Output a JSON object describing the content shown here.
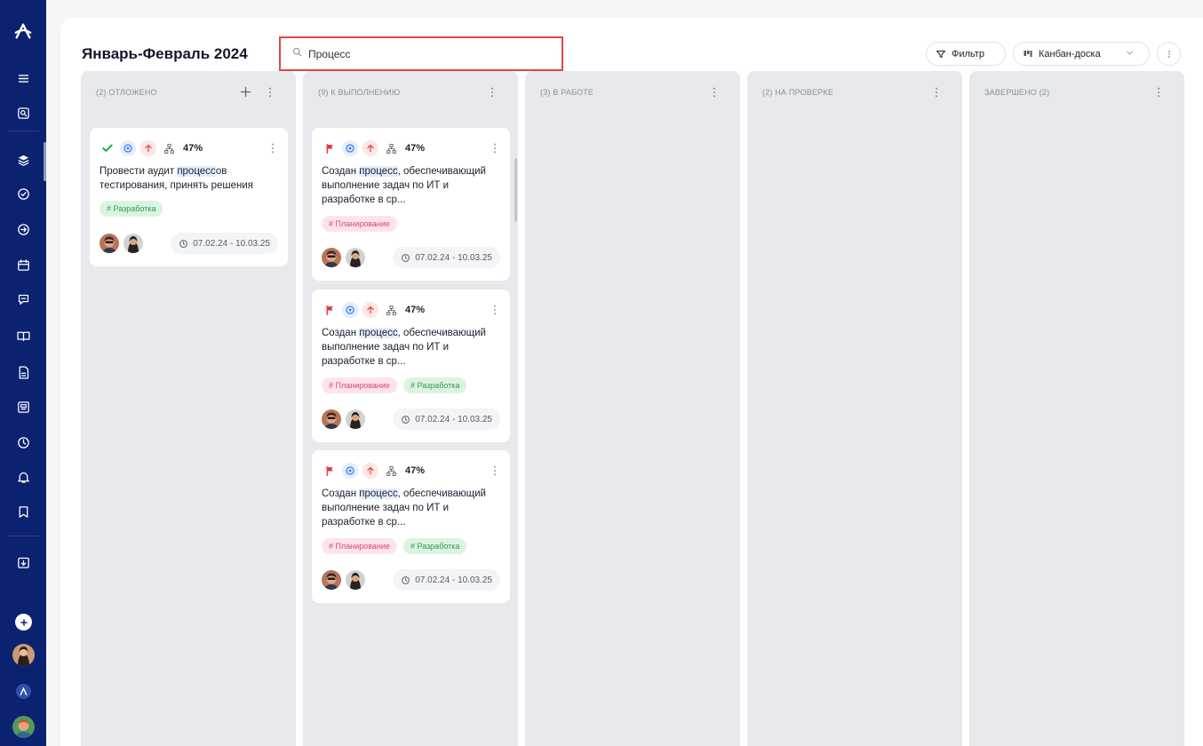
{
  "sidebar": {
    "logo": "app-logo-icon",
    "items": [
      "menu-icon",
      "search-doc-icon",
      "layers-icon",
      "check-circle-icon",
      "arrow-circle-icon",
      "calendar-icon",
      "chat-icon",
      "book-icon",
      "document-icon",
      "news-icon",
      "clock-icon",
      "bell-icon",
      "bookmark-icon",
      "download-folder-icon"
    ]
  },
  "header": {
    "title": "Январь-Февраль 2024",
    "search_value": "Процесс",
    "filter_label": "Фильтр",
    "view_label": "Канбан-доска"
  },
  "columns": [
    {
      "title": "(2) ОТЛОЖЕНО",
      "cards": [
        {
          "percent": "47%",
          "title_pre": "Провести аудит ",
          "title_hl": "процесс",
          "title_post": "ов тестирования, принять решения",
          "tags": [
            "# Разработка"
          ],
          "dates": "07.02.24 - 10.03.25"
        }
      ]
    },
    {
      "title": "(9) К ВЫПОЛНЕНИЮ",
      "cards": [
        {
          "percent": "47%",
          "title_pre": "Создан ",
          "title_hl": "процесс",
          "title_post": ", обеспечивающий выполнение задач по ИТ и разработке в ср...",
          "tags": [
            "# Планирование"
          ],
          "dates": "07.02.24 - 10.03.25"
        },
        {
          "percent": "47%",
          "title_pre": "Создан ",
          "title_hl": "процесс",
          "title_post": ", обеспечивающий выполнение задач по ИТ и разработке в ср...",
          "tags": [
            "# Планирование",
            "# Разработка"
          ],
          "dates": "07.02.24 - 10.03.25"
        },
        {
          "percent": "47%",
          "title_pre": "Создан ",
          "title_hl": "процесс",
          "title_post": ", обеспечивающий выполнение задач по ИТ и разработке в ср...",
          "tags": [
            "# Планирование",
            "# Разработка"
          ],
          "dates": "07.02.24 - 10.03.25"
        }
      ]
    },
    {
      "title": "(3) В РАБОТЕ",
      "cards": []
    },
    {
      "title": "(2) НА ПРОВЕРКЕ",
      "cards": []
    },
    {
      "title": "ЗАВЕРШЕНО (2)",
      "cards": []
    }
  ],
  "colors": {
    "sidebar": "#0a2270",
    "search_border": "#e04646",
    "tag_green": "#2f9a52",
    "tag_pink": "#d8457a",
    "flag_red": "#e8323c",
    "check_green": "#1fa83f"
  }
}
